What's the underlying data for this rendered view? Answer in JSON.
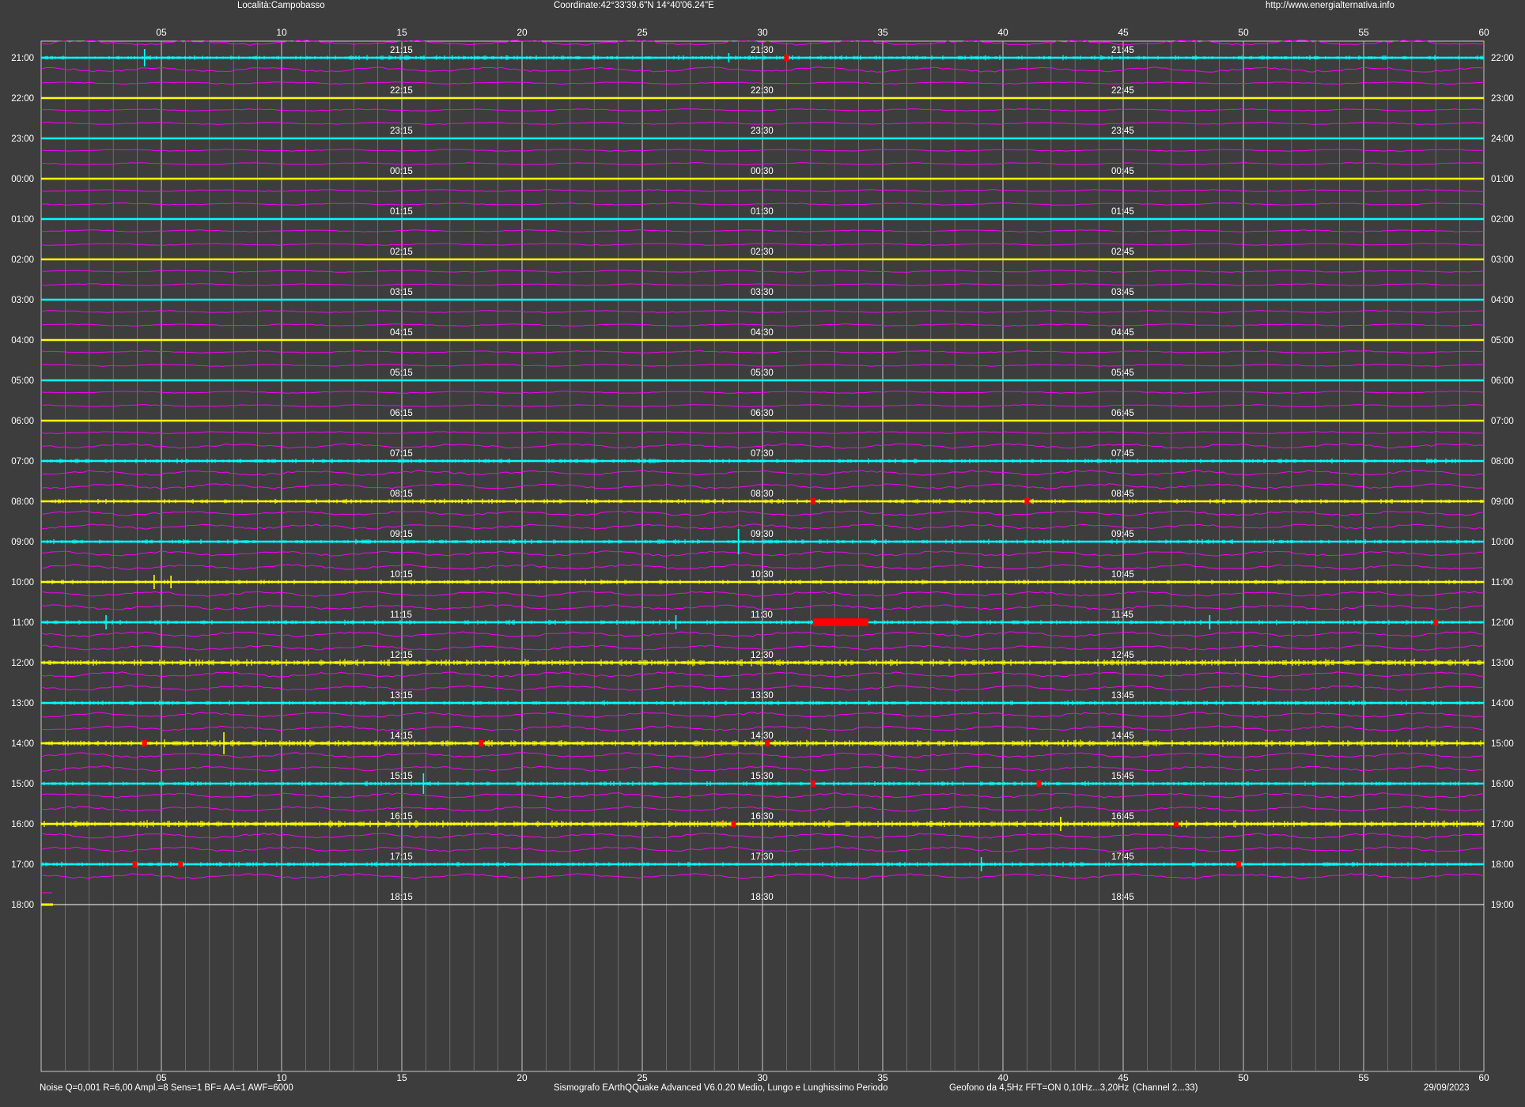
{
  "header": {
    "location": "Località:Campobasso",
    "coordinates": "Coordinate:42°33'39.6\"N  14°40'06.24\"E",
    "website": "http://www.energialternativa.info"
  },
  "footer": {
    "noise": "Noise Q=0,001 R=6,00 Ampl.=8 Sens=1 BF= AA=1 AWF=6000",
    "software": "Sismografo  EArthQQuake Advanced V6.0.20  Medio, Lungo e Lunghissimo Periodo",
    "geophone": "Geofono da 4,5Hz FFT=ON 0,10Hz...3,20Hz",
    "channel": "(Channel 2...33)",
    "date": "29/09/2023"
  },
  "colors": {
    "background": "#3d3d3d",
    "trace_cyan": "#00ffff",
    "trace_yellow": "#ffff00",
    "long_period": "#ff00ff",
    "event_marker": "#ff0000",
    "grid_major": "#c8c8c8",
    "grid_minor": "#787878"
  },
  "chart_data": {
    "type": "line",
    "title": "",
    "xlabel": "",
    "ylabel": "",
    "xlim": [
      0,
      60
    ],
    "x_ticks": [
      "05",
      "10",
      "15",
      "20",
      "25",
      "30",
      "35",
      "40",
      "45",
      "50",
      "55",
      "60"
    ],
    "minor_tick_step_minutes": 1,
    "rows": [
      {
        "left": "21:00",
        "right": "22:00",
        "marks": [
          "21:15",
          "21:30",
          "21:45"
        ],
        "color": "cyan",
        "activity": "medium"
      },
      {
        "left": "22:00",
        "right": "23:00",
        "marks": [
          "22:15",
          "22:30",
          "22:45"
        ],
        "color": "yellow",
        "activity": "flat"
      },
      {
        "left": "23:00",
        "right": "24:00",
        "marks": [
          "23:15",
          "23:30",
          "23:45"
        ],
        "color": "cyan",
        "activity": "flat"
      },
      {
        "left": "00:00",
        "right": "01:00",
        "marks": [
          "00:15",
          "00:30",
          "00:45"
        ],
        "color": "yellow",
        "activity": "flat"
      },
      {
        "left": "01:00",
        "right": "02:00",
        "marks": [
          "01:15",
          "01:30",
          "01:45"
        ],
        "color": "cyan",
        "activity": "flat"
      },
      {
        "left": "02:00",
        "right": "03:00",
        "marks": [
          "02:15",
          "02:30",
          "02:45"
        ],
        "color": "yellow",
        "activity": "flat"
      },
      {
        "left": "03:00",
        "right": "04:00",
        "marks": [
          "03:15",
          "03:30",
          "03:45"
        ],
        "color": "cyan",
        "activity": "flat"
      },
      {
        "left": "04:00",
        "right": "05:00",
        "marks": [
          "04:15",
          "04:30",
          "04:45"
        ],
        "color": "yellow",
        "activity": "flat"
      },
      {
        "left": "05:00",
        "right": "06:00",
        "marks": [
          "05:15",
          "05:30",
          "05:45"
        ],
        "color": "cyan",
        "activity": "flat"
      },
      {
        "left": "06:00",
        "right": "07:00",
        "marks": [
          "06:15",
          "06:30",
          "06:45"
        ],
        "color": "yellow",
        "activity": "flat"
      },
      {
        "left": "07:00",
        "right": "08:00",
        "marks": [
          "07:15",
          "07:30",
          "07:45"
        ],
        "color": "cyan",
        "activity": "medium"
      },
      {
        "left": "08:00",
        "right": "09:00",
        "marks": [
          "08:15",
          "08:30",
          "08:45"
        ],
        "color": "yellow",
        "activity": "medium"
      },
      {
        "left": "09:00",
        "right": "10:00",
        "marks": [
          "09:15",
          "09:30",
          "09:45"
        ],
        "color": "cyan",
        "activity": "medium"
      },
      {
        "left": "10:00",
        "right": "11:00",
        "marks": [
          "10:15",
          "10:30",
          "10:45"
        ],
        "color": "yellow",
        "activity": "medium"
      },
      {
        "left": "11:00",
        "right": "12:00",
        "marks": [
          "11:15",
          "11:30",
          "11:45"
        ],
        "color": "cyan",
        "activity": "medium"
      },
      {
        "left": "12:00",
        "right": "13:00",
        "marks": [
          "12:15",
          "12:30",
          "12:45"
        ],
        "color": "yellow",
        "activity": "high"
      },
      {
        "left": "13:00",
        "right": "14:00",
        "marks": [
          "13:15",
          "13:30",
          "13:45"
        ],
        "color": "cyan",
        "activity": "medium"
      },
      {
        "left": "14:00",
        "right": "15:00",
        "marks": [
          "14:15",
          "14:30",
          "14:45"
        ],
        "color": "yellow",
        "activity": "high"
      },
      {
        "left": "15:00",
        "right": "16:00",
        "marks": [
          "15:15",
          "15:30",
          "15:45"
        ],
        "color": "cyan",
        "activity": "medium"
      },
      {
        "left": "16:00",
        "right": "17:00",
        "marks": [
          "16:15",
          "16:30",
          "16:45"
        ],
        "color": "yellow",
        "activity": "high"
      },
      {
        "left": "17:00",
        "right": "18:00",
        "marks": [
          "17:15",
          "17:30",
          "17:45"
        ],
        "color": "cyan",
        "activity": "medium"
      },
      {
        "left": "18:00",
        "right": "19:00",
        "marks": [
          "18:15",
          "18:30",
          "18:45"
        ],
        "color": "white",
        "activity": "flat"
      }
    ],
    "events": [
      {
        "row": 0,
        "start": 31.0,
        "end": 31.0
      },
      {
        "row": 11,
        "start": 32.1,
        "end": 32.1
      },
      {
        "row": 11,
        "start": 41.0,
        "end": 41.0
      },
      {
        "row": 14,
        "start": 32.1,
        "end": 34.4
      },
      {
        "row": 14,
        "start": 58.0,
        "end": 58.0
      },
      {
        "row": 17,
        "start": 4.3,
        "end": 4.3
      },
      {
        "row": 17,
        "start": 18.3,
        "end": 18.3
      },
      {
        "row": 17,
        "start": 30.2,
        "end": 30.2
      },
      {
        "row": 18,
        "start": 32.1,
        "end": 32.1
      },
      {
        "row": 18,
        "start": 41.5,
        "end": 41.5
      },
      {
        "row": 19,
        "start": 28.8,
        "end": 28.8
      },
      {
        "row": 19,
        "start": 47.2,
        "end": 47.2
      },
      {
        "row": 20,
        "start": 3.9,
        "end": 3.9
      },
      {
        "row": 20,
        "start": 5.8,
        "end": 5.8
      },
      {
        "row": 20,
        "start": 49.8,
        "end": 49.8
      }
    ],
    "spikes": [
      {
        "row": 0,
        "x": 4.3,
        "amp": 11
      },
      {
        "row": 0,
        "x": 28.6,
        "amp": 6
      },
      {
        "row": 9,
        "x": 29.0,
        "amp": 0
      },
      {
        "row": 12,
        "x": 29.0,
        "amp": 16
      },
      {
        "row": 13,
        "x": 4.7,
        "amp": 9
      },
      {
        "row": 13,
        "x": 5.4,
        "amp": 8
      },
      {
        "row": 14,
        "x": 2.7,
        "amp": 9
      },
      {
        "row": 14,
        "x": 26.4,
        "amp": 9
      },
      {
        "row": 14,
        "x": 48.6,
        "amp": 9
      },
      {
        "row": 17,
        "x": 7.6,
        "amp": 14
      },
      {
        "row": 18,
        "x": 15.9,
        "amp": 13
      },
      {
        "row": 19,
        "x": 42.4,
        "amp": 9
      },
      {
        "row": 20,
        "x": 39.1,
        "amp": 9
      }
    ]
  }
}
